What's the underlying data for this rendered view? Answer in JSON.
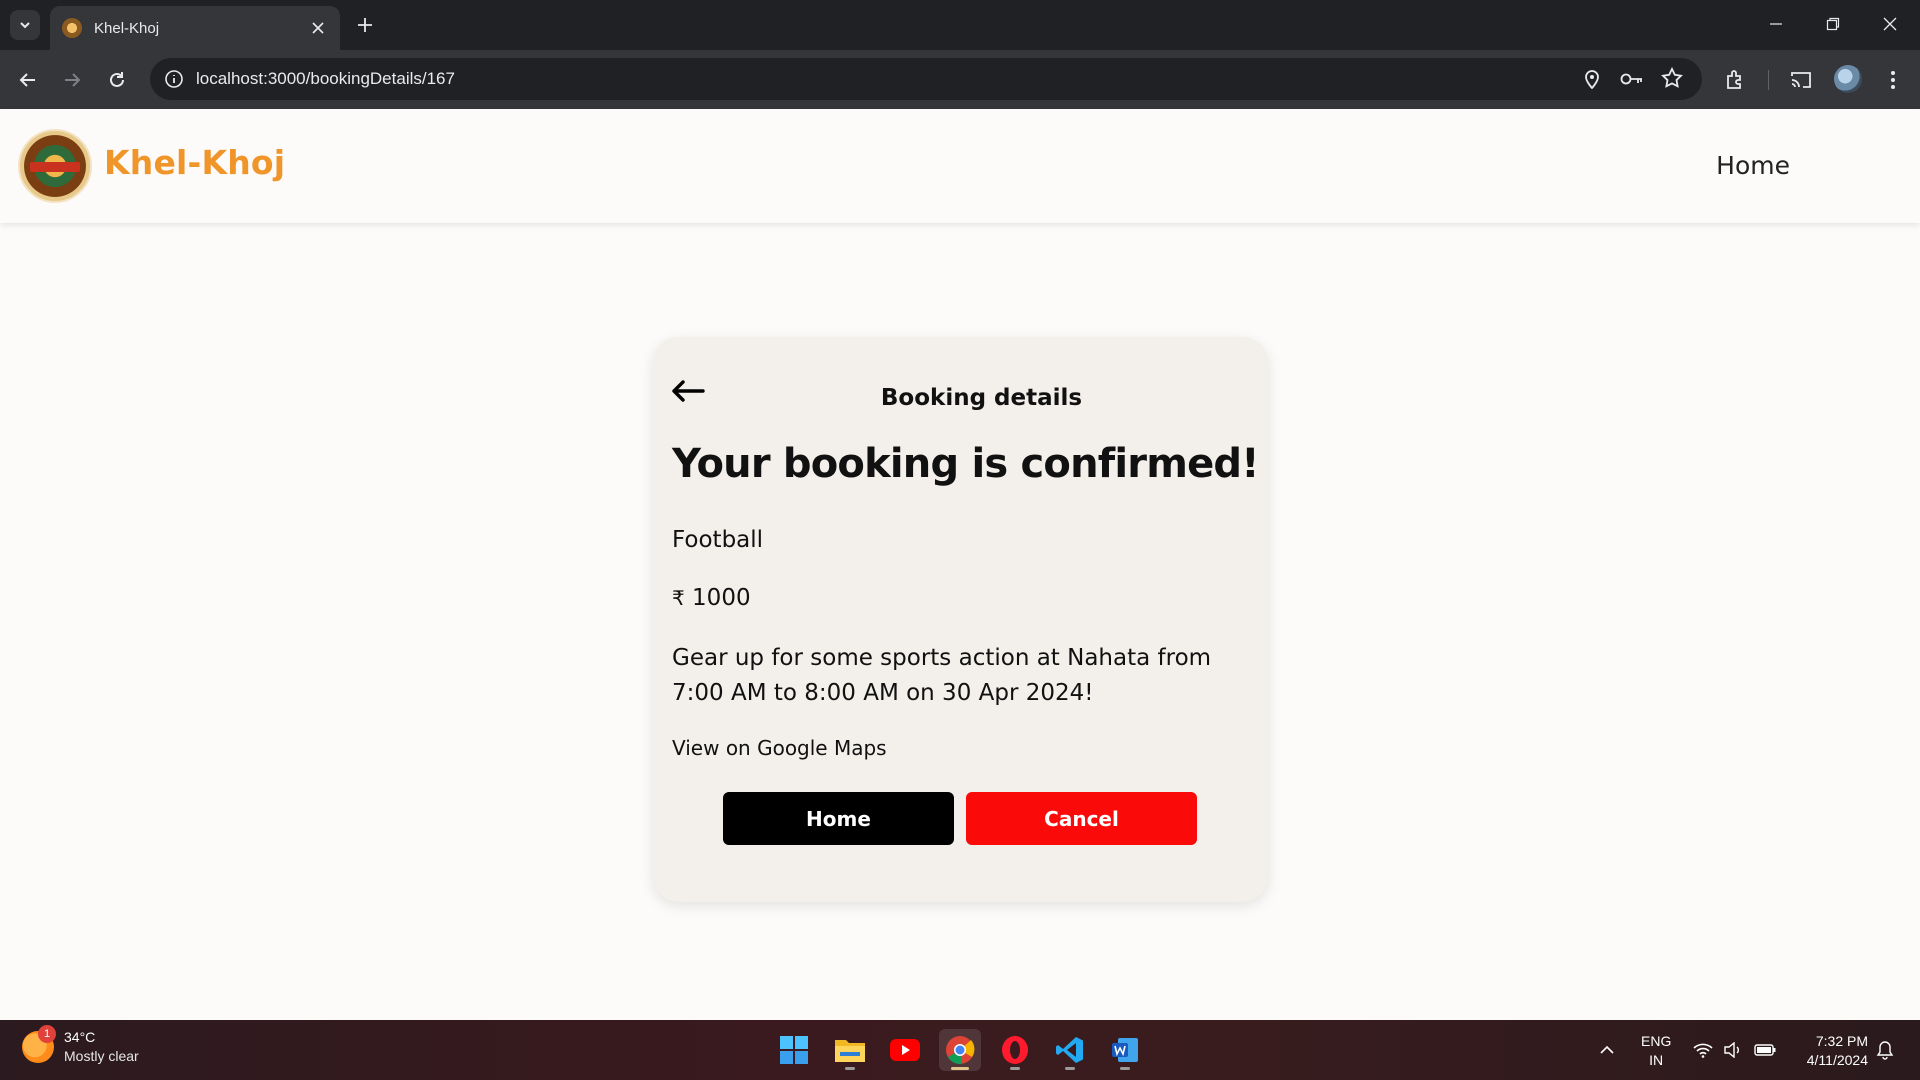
{
  "browser": {
    "tab_title": "Khel-Khoj",
    "url": "localhost:3000/bookingDetails/167"
  },
  "header": {
    "brand": "Khel-Khoj",
    "nav_home": "Home",
    "brand_color": "#f0952a"
  },
  "booking": {
    "panel_title": "Booking details",
    "headline": "Your booking is confirmed!",
    "sport": "Football",
    "currency_symbol": "₹",
    "amount": "1000",
    "description": "Gear up for some sports action at Nahata from 7:00 AM to 8:00 AM on 30 Apr 2024!",
    "maps_link": "View on Google Maps",
    "home_button": "Home",
    "cancel_button": "Cancel",
    "cancel_color": "#fb0a0a"
  },
  "taskbar": {
    "weather_badge": "1",
    "temperature": "34°C",
    "condition": "Mostly clear",
    "language": "ENG",
    "region": "IN",
    "time": "7:32 PM",
    "date": "4/11/2024",
    "apps": [
      "windows-start",
      "file-explorer",
      "youtube",
      "chrome",
      "opera",
      "vscode",
      "word"
    ]
  }
}
